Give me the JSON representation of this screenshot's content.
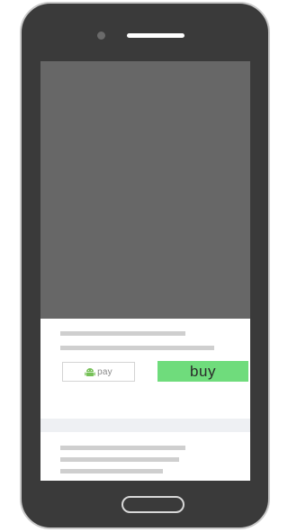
{
  "device": {
    "frame_color": "#3a3a3a",
    "bezel_outline_color": "#c9c9c9",
    "camera_icon": "camera-icon",
    "speaker_icon": "speaker-grille",
    "home_button_icon": "home-button"
  },
  "screen": {
    "hero_color": "#676767",
    "placeholder_line_color": "#cfcfcf",
    "band_color": "#eef0f3"
  },
  "payment": {
    "android_pay_label": "pay",
    "android_icon": "android-icon",
    "android_color": "#77c159",
    "buy_label": "buy",
    "buy_color": "#6fdc7c"
  }
}
